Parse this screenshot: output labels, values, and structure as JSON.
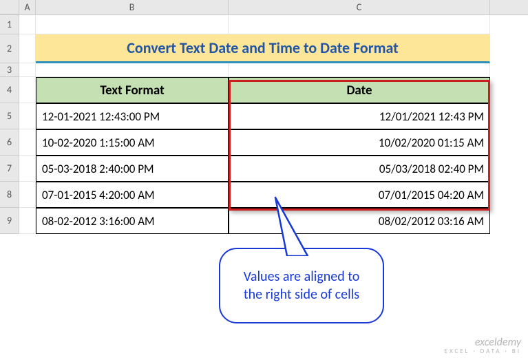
{
  "columns": {
    "A": "A",
    "B": "B",
    "C": "C"
  },
  "rows": [
    "1",
    "2",
    "3",
    "4",
    "5",
    "6",
    "7",
    "8",
    "9"
  ],
  "title": "Convert Text Date and Time to Date Format",
  "table": {
    "header_text": "Text Format",
    "header_date": "Date",
    "data": [
      {
        "text": "12-01-2021  12:43:00 PM",
        "date": "12/01/2021 12:43 PM"
      },
      {
        "text": "10-02-2020  1:15:00 AM",
        "date": "10/02/2020 01:15 AM"
      },
      {
        "text": "05-03-2018  2:40:00 PM",
        "date": "05/03/2018 02:40 PM"
      },
      {
        "text": "07-01-2015  4:20:00 AM",
        "date": "07/01/2015 04:20 AM"
      },
      {
        "text": "08-02-2012  3:16:00 AM",
        "date": "08/02/2012 03:16 AM"
      }
    ]
  },
  "callout_text": "Values are aligned to the right side of cells",
  "watermark": {
    "brand": "exceldemy",
    "tagline": "EXCEL · DATA · BI"
  }
}
